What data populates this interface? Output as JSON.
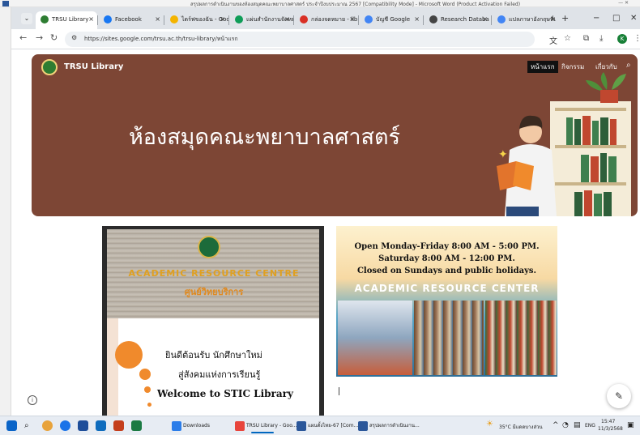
{
  "word_window": {
    "title": "สรุปผลการดำเนินงานของห้องสมุดคณะพยาบาลศาสตร์ ประจำปีงบประมาณ 2567 [Compatibility Mode] - Microsoft Word (Product Activation Failed)"
  },
  "browser": {
    "tabs": [
      {
        "label": "TRSU Library",
        "color": "#2e7d32"
      },
      {
        "label": "Facebook",
        "color": "#1877f2"
      },
      {
        "label": "ไดร์ฟของฉัน - Goo",
        "color": "#f4b400"
      },
      {
        "label": "แผ่นสำนักงานจัดหมู่",
        "color": "#0f9d58"
      },
      {
        "label": "กล่องจดหมาย - libr",
        "color": "#d93025"
      },
      {
        "label": "บัญชี Google",
        "color": "#4285f4"
      },
      {
        "label": "Research Databa",
        "color": "#444444"
      },
      {
        "label": "แปลภาษาอังกฤษที่เ",
        "color": "#4285f4"
      }
    ],
    "new_tab": "+",
    "window_controls": {
      "minimize": "−",
      "maximize": "□",
      "close": "✕"
    },
    "url": "https://sites.google.com/trsu.ac.th/trsu-library/หน้าแรก",
    "profile_initial": "K"
  },
  "site": {
    "name": "TRSU Library",
    "nav": [
      "หน้าแรก",
      "กิจกรรม",
      "เกี่ยวกับ"
    ],
    "hero_title": "ห้องสมุดคณะพยาบาลศาสตร์",
    "left_card": {
      "sign_en": "ACADEMIC RESOURCE CENTRE",
      "sign_th": "ศูนย์วิทยบริการ",
      "line1": "ยินดีต้อนรับ นักศึกษาใหม่",
      "line2": "สู่สังคมแห่งการเรียนรู้",
      "line3": "Welcome to STIC Library"
    },
    "right_card": {
      "hours1": "Open Monday-Friday 8:00 AM - 5:00 PM.",
      "hours2": "Saturday 8:00 AM - 12:00 PM.",
      "hours3": "Closed on Sundays and public holidays.",
      "center": "ACADEMIC RESOURCE CENTER"
    }
  },
  "taskbar": {
    "apps": [
      {
        "label": "Downloads",
        "color": "#2b7de9"
      },
      {
        "label": "TRSU Library - Goo...",
        "color": "#e8453c",
        "active": true
      },
      {
        "label": "แผนตั้งไทย-67 [Com...",
        "color": "#2b579a"
      },
      {
        "label": "สรุปผลการดำเนินงาน...",
        "color": "#2b579a"
      }
    ],
    "weather": "35°C มีแดดบางส่วน",
    "language": "ENG",
    "time": "15:47",
    "date": "11/3/2568"
  }
}
